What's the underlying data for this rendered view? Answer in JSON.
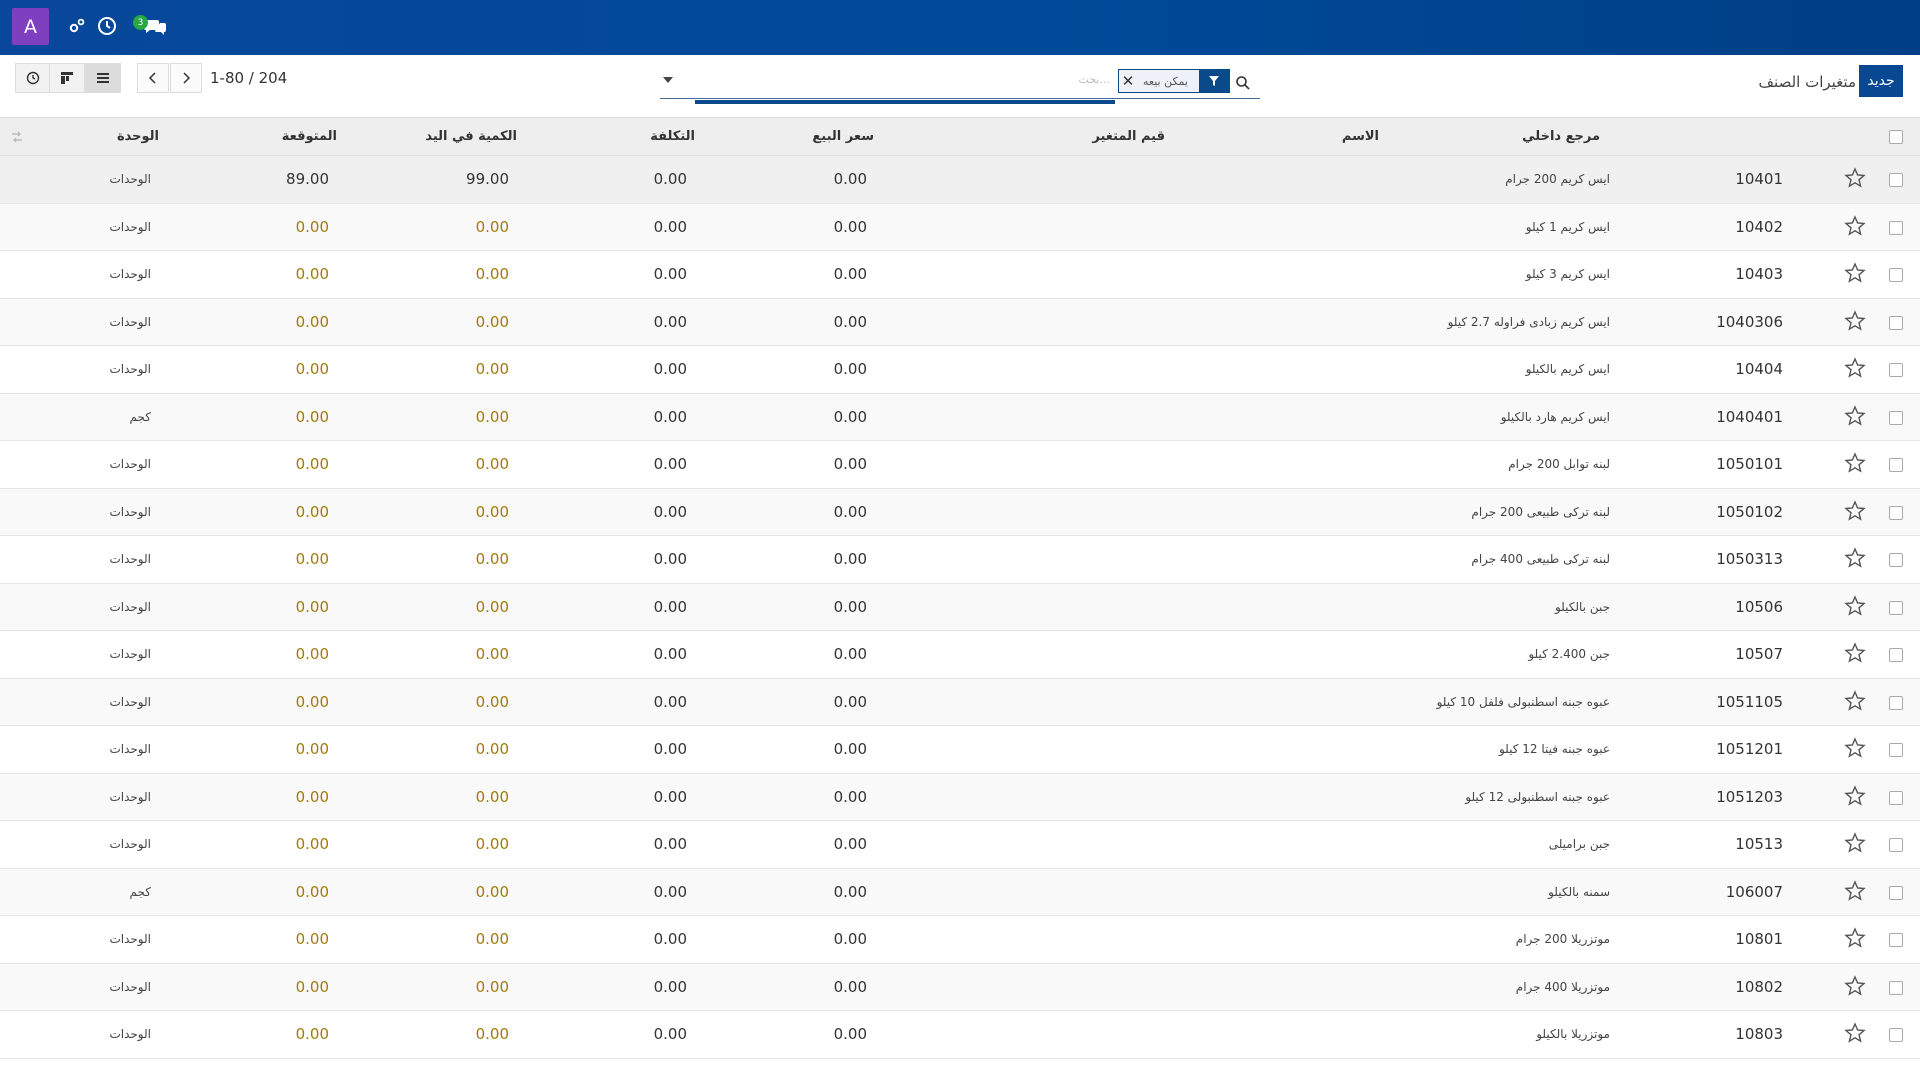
{
  "topbar": {
    "avatar_letter": "A",
    "chat_badge": "3",
    "icons": [
      "settings-icon",
      "clock-icon",
      "chat-icon"
    ]
  },
  "controlpanel": {
    "new_button": "جديد",
    "breadcrumb": "متغيرات الصنف",
    "facet_label": "يمكن بيعه",
    "search_placeholder": "بحث...",
    "pager": "1-80 / 204"
  },
  "table": {
    "headers": {
      "ref": "مرجع داخلي",
      "name": "الاسم",
      "variants": "قيم المتغير",
      "sale_price": "سعر البيع",
      "cost": "التكلفة",
      "qty_on_hand": "الكمية في اليد",
      "forecast": "المتوقعة",
      "uom": "الوحدة"
    },
    "rows": [
      {
        "ref": "10401",
        "name": "ايس كريم 200 جرام",
        "sale": "0.00",
        "cost": "0.00",
        "qty": "99.00",
        "forecast": "89.00",
        "uom": "الوحدات",
        "warn": false
      },
      {
        "ref": "10402",
        "name": "ايس كريم 1 كيلو",
        "sale": "0.00",
        "cost": "0.00",
        "qty": "0.00",
        "forecast": "0.00",
        "uom": "الوحدات",
        "warn": true
      },
      {
        "ref": "10403",
        "name": "ايس كريم 3 كيلو",
        "sale": "0.00",
        "cost": "0.00",
        "qty": "0.00",
        "forecast": "0.00",
        "uom": "الوحدات",
        "warn": true
      },
      {
        "ref": "1040306",
        "name": "ايس كريم زبادى فراوله 2.7 كيلو",
        "sale": "0.00",
        "cost": "0.00",
        "qty": "0.00",
        "forecast": "0.00",
        "uom": "الوحدات",
        "warn": true
      },
      {
        "ref": "10404",
        "name": "ايس كريم بالكيلو",
        "sale": "0.00",
        "cost": "0.00",
        "qty": "0.00",
        "forecast": "0.00",
        "uom": "الوحدات",
        "warn": true
      },
      {
        "ref": "1040401",
        "name": "ايس كريم هارد بالكيلو",
        "sale": "0.00",
        "cost": "0.00",
        "qty": "0.00",
        "forecast": "0.00",
        "uom": "كجم",
        "warn": true
      },
      {
        "ref": "1050101",
        "name": "لبنه توابل 200 جرام",
        "sale": "0.00",
        "cost": "0.00",
        "qty": "0.00",
        "forecast": "0.00",
        "uom": "الوحدات",
        "warn": true
      },
      {
        "ref": "1050102",
        "name": "لبنه تركى طبيعى 200 جرام",
        "sale": "0.00",
        "cost": "0.00",
        "qty": "0.00",
        "forecast": "0.00",
        "uom": "الوحدات",
        "warn": true
      },
      {
        "ref": "1050313",
        "name": "لبنه تركى طبيعى 400 جرام",
        "sale": "0.00",
        "cost": "0.00",
        "qty": "0.00",
        "forecast": "0.00",
        "uom": "الوحدات",
        "warn": true
      },
      {
        "ref": "10506",
        "name": "جبن بالكيلو",
        "sale": "0.00",
        "cost": "0.00",
        "qty": "0.00",
        "forecast": "0.00",
        "uom": "الوحدات",
        "warn": true
      },
      {
        "ref": "10507",
        "name": "جبن 2.400 كيلو",
        "sale": "0.00",
        "cost": "0.00",
        "qty": "0.00",
        "forecast": "0.00",
        "uom": "الوحدات",
        "warn": true
      },
      {
        "ref": "1051105",
        "name": "عبوه جبنه اسطنبولى فلفل 10 كيلو",
        "sale": "0.00",
        "cost": "0.00",
        "qty": "0.00",
        "forecast": "0.00",
        "uom": "الوحدات",
        "warn": true
      },
      {
        "ref": "1051201",
        "name": "عبوه جبنه فيتا 12 كيلو",
        "sale": "0.00",
        "cost": "0.00",
        "qty": "0.00",
        "forecast": "0.00",
        "uom": "الوحدات",
        "warn": true
      },
      {
        "ref": "1051203",
        "name": "عبوه جبنه اسطنبولى 12 كيلو",
        "sale": "0.00",
        "cost": "0.00",
        "qty": "0.00",
        "forecast": "0.00",
        "uom": "الوحدات",
        "warn": true
      },
      {
        "ref": "10513",
        "name": "جبن براميلى",
        "sale": "0.00",
        "cost": "0.00",
        "qty": "0.00",
        "forecast": "0.00",
        "uom": "الوحدات",
        "warn": true
      },
      {
        "ref": "106007",
        "name": "سمنه بالكيلو",
        "sale": "0.00",
        "cost": "0.00",
        "qty": "0.00",
        "forecast": "0.00",
        "uom": "كجم",
        "warn": true
      },
      {
        "ref": "10801",
        "name": "موتزريلا 200 جرام",
        "sale": "0.00",
        "cost": "0.00",
        "qty": "0.00",
        "forecast": "0.00",
        "uom": "الوحدات",
        "warn": true
      },
      {
        "ref": "10802",
        "name": "موتزريلا 400 جرام",
        "sale": "0.00",
        "cost": "0.00",
        "qty": "0.00",
        "forecast": "0.00",
        "uom": "الوحدات",
        "warn": true
      },
      {
        "ref": "10803",
        "name": "موتزريلا بالكيلو",
        "sale": "0.00",
        "cost": "0.00",
        "qty": "0.00",
        "forecast": "0.00",
        "uom": "الوحدات",
        "warn": true
      }
    ]
  },
  "colors": {
    "topbar": "#004a99",
    "avatar": "#7e3fc1",
    "primary_button": "#084792",
    "warning_text": "#a07a0c",
    "badge": "#27a844"
  }
}
